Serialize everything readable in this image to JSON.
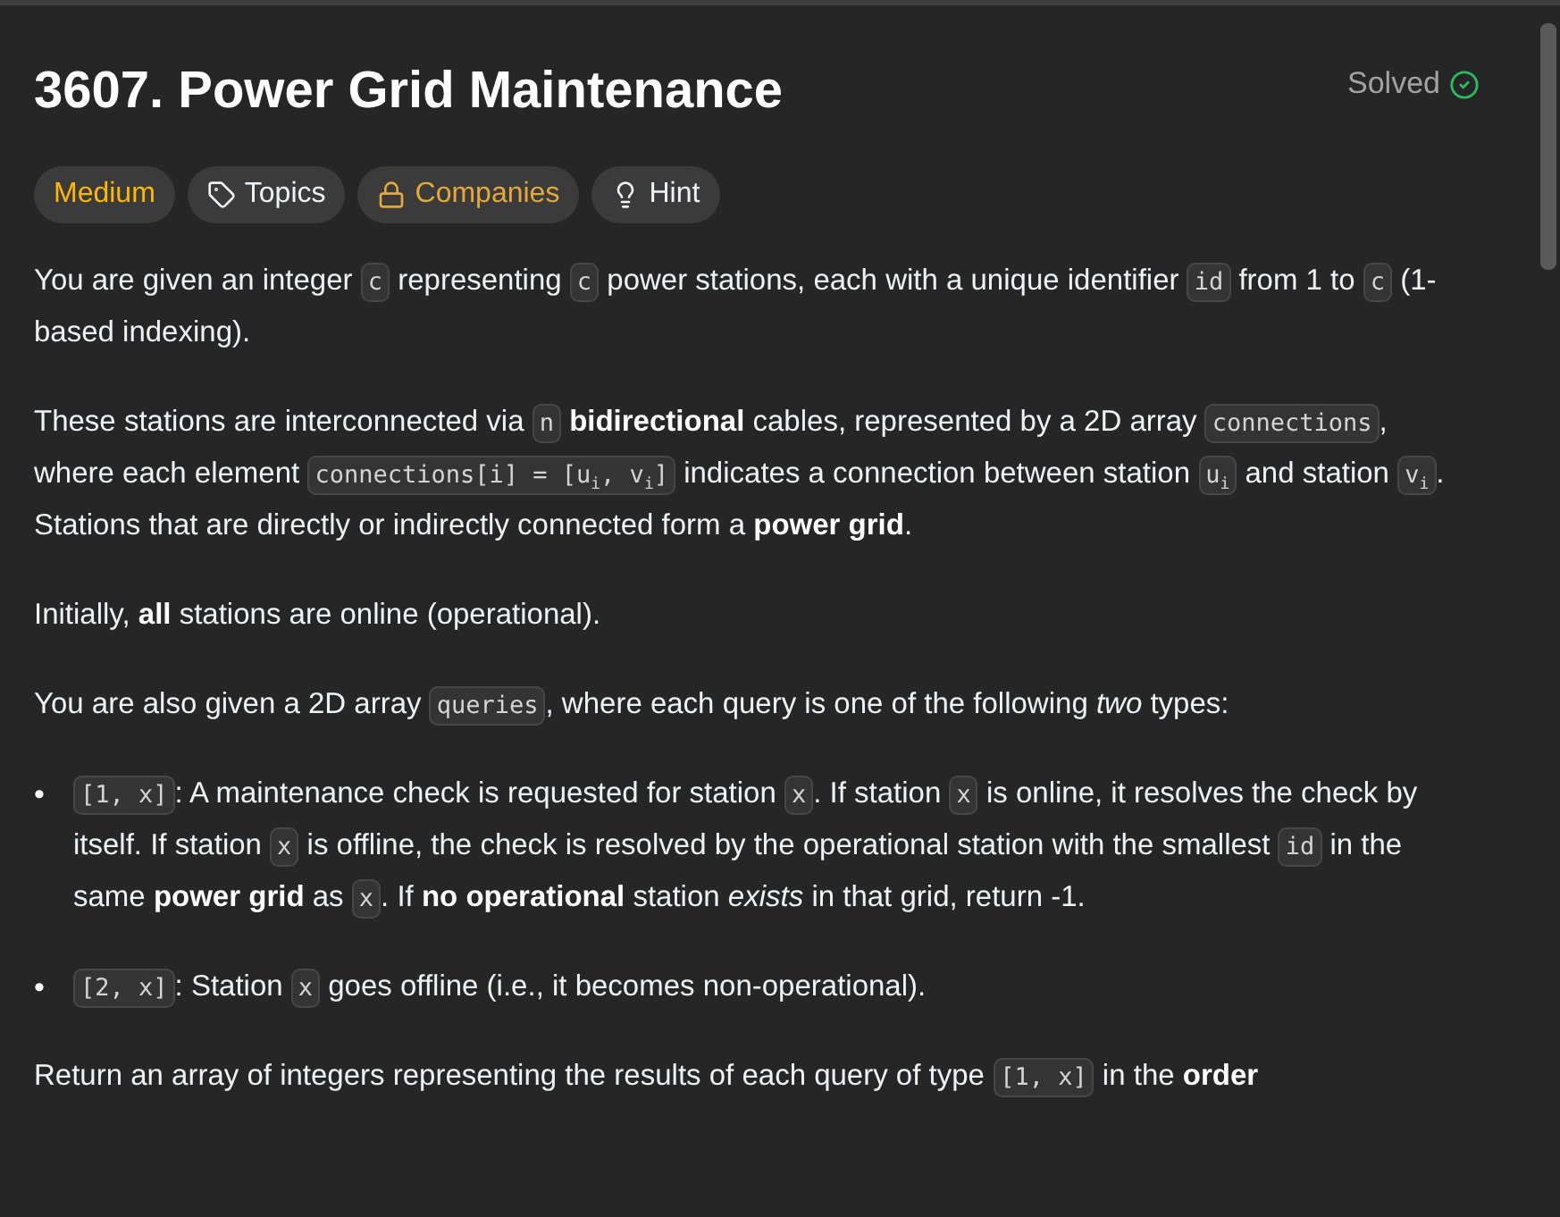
{
  "title": "3607. Power Grid Maintenance",
  "status": {
    "label": "Solved",
    "solved": true
  },
  "tags": [
    {
      "kind": "difficulty",
      "label": "Medium"
    },
    {
      "kind": "topics",
      "label": "Topics"
    },
    {
      "kind": "companies",
      "label": "Companies"
    },
    {
      "kind": "hint",
      "label": "Hint"
    }
  ],
  "description": [
    {
      "kind": "paragraph",
      "segments": [
        {
          "kind": "text",
          "text": "You are given an integer "
        },
        {
          "kind": "code",
          "text": "c"
        },
        {
          "kind": "text",
          "text": " representing "
        },
        {
          "kind": "code",
          "text": "c"
        },
        {
          "kind": "text",
          "text": " power stations, each with a unique identifier "
        },
        {
          "kind": "code",
          "text": "id"
        },
        {
          "kind": "text",
          "text": " from 1 to "
        },
        {
          "kind": "code",
          "text": "c"
        },
        {
          "kind": "text",
          "text": " (1-based indexing)."
        }
      ]
    },
    {
      "kind": "paragraph",
      "segments": [
        {
          "kind": "text",
          "text": "These stations are interconnected via "
        },
        {
          "kind": "code",
          "text": "n"
        },
        {
          "kind": "text",
          "text": " **bidirectional** cables, represented by a 2D array "
        },
        {
          "kind": "code",
          "text": "connections"
        },
        {
          "kind": "text",
          "text": ", where each element "
        },
        {
          "kind": "code",
          "text": "connections[i] = [u$_{i}$, v$_{i}$]"
        },
        {
          "kind": "text",
          "text": " indicates a connection between station "
        },
        {
          "kind": "code",
          "text": "u$_{i}$"
        },
        {
          "kind": "text",
          "text": " and station "
        },
        {
          "kind": "code",
          "text": "v$_{i}$"
        },
        {
          "kind": "text",
          "text": ". Stations that are directly or indirectly connected form a **power grid**."
        }
      ]
    },
    {
      "kind": "paragraph",
      "segments": [
        {
          "kind": "text",
          "text": "Initially, **all** stations are online (operational)."
        }
      ]
    },
    {
      "kind": "paragraph",
      "segments": [
        {
          "kind": "text",
          "text": "You are also given a 2D array "
        },
        {
          "kind": "code",
          "text": "queries"
        },
        {
          "kind": "text",
          "text": ", where each query is one of the following *two* types:"
        }
      ]
    },
    {
      "kind": "bullets",
      "items": [
        {
          "marker": "•",
          "segments": [
            {
              "kind": "code",
              "text": "[1, x]"
            },
            {
              "kind": "text",
              "text": ": A maintenance check is requested for station "
            },
            {
              "kind": "code",
              "text": "x"
            },
            {
              "kind": "text",
              "text": ". If station "
            },
            {
              "kind": "code",
              "text": "x"
            },
            {
              "kind": "text",
              "text": " is online, it resolves the check by itself. If station "
            },
            {
              "kind": "code",
              "text": "x"
            },
            {
              "kind": "text",
              "text": " is offline, the check is resolved by the operational station with the smallest "
            },
            {
              "kind": "code",
              "text": "id"
            },
            {
              "kind": "text",
              "text": " in the same **power grid** as "
            },
            {
              "kind": "code",
              "text": "x"
            },
            {
              "kind": "text",
              "text": ". If **no operational** station *exists* in that grid, return -1."
            }
          ]
        },
        {
          "marker": "•",
          "segments": [
            {
              "kind": "code",
              "text": "[2, x]"
            },
            {
              "kind": "text",
              "text": ": Station "
            },
            {
              "kind": "code",
              "text": "x"
            },
            {
              "kind": "text",
              "text": " goes offline (i.e., it becomes non-operational)."
            }
          ]
        }
      ]
    },
    {
      "kind": "paragraph",
      "segments": [
        {
          "kind": "text",
          "text": "Return an array of integers representing the results of each query of type "
        },
        {
          "kind": "code",
          "text": "[1, x]"
        },
        {
          "kind": "text",
          "text": " in the **order**"
        }
      ]
    }
  ]
}
